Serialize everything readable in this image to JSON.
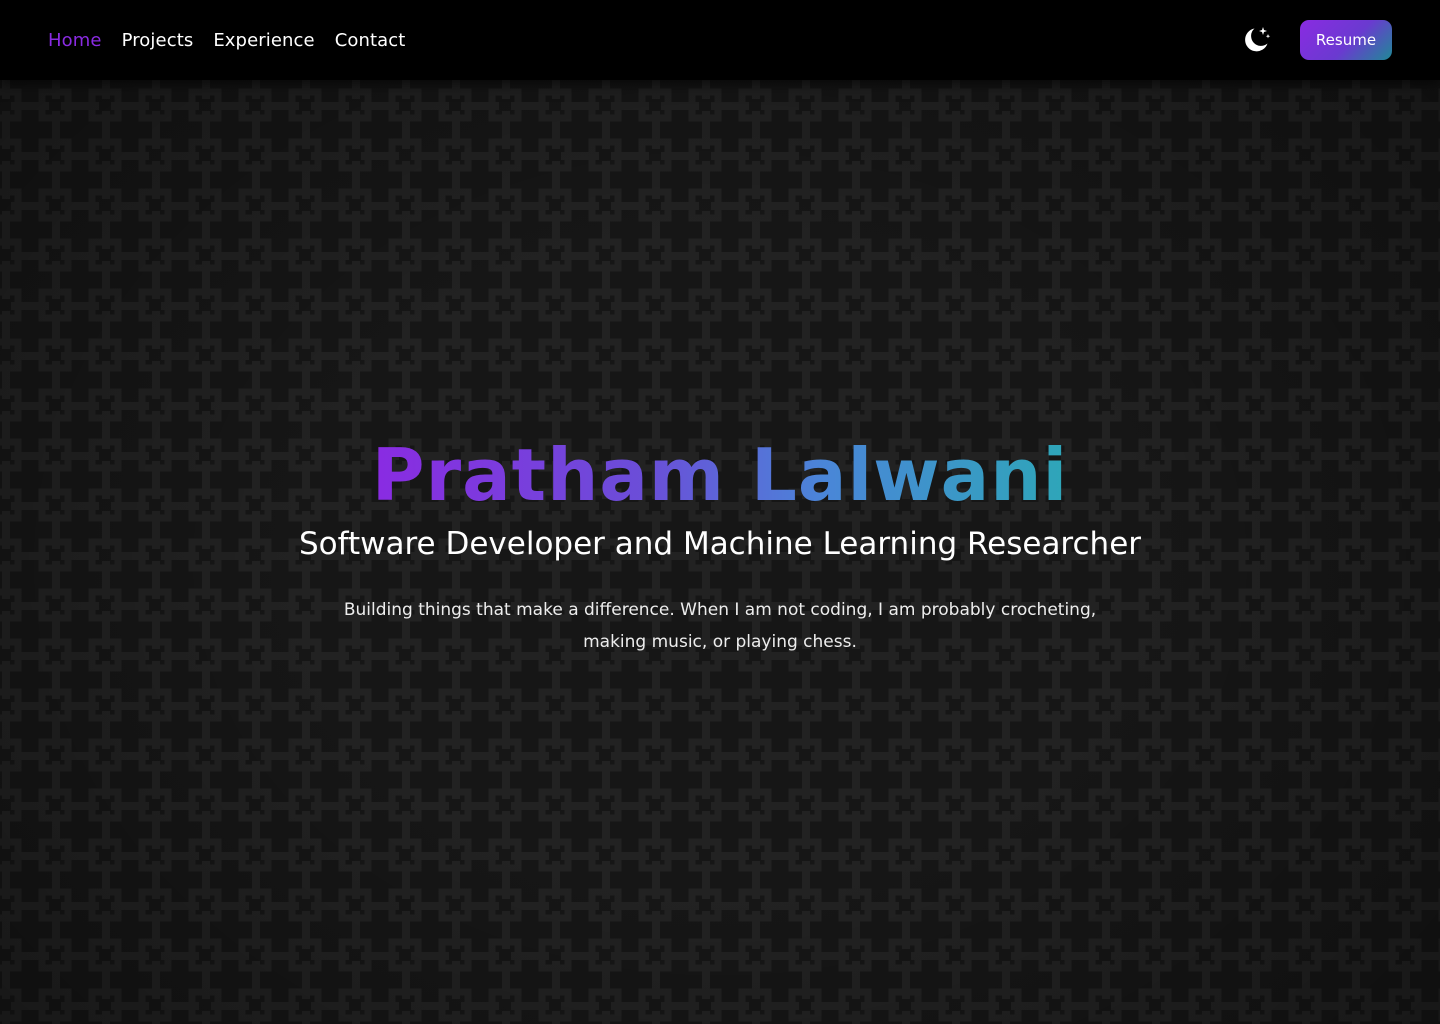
{
  "nav": {
    "links": [
      {
        "label": "Home",
        "active": true
      },
      {
        "label": "Projects",
        "active": false
      },
      {
        "label": "Experience",
        "active": false
      },
      {
        "label": "Contact",
        "active": false
      }
    ],
    "theme_icon": "moon-stars-icon",
    "resume_label": "Resume"
  },
  "hero": {
    "name": "Pratham Lalwani",
    "subtitle": "Software Developer and Machine Learning Researcher",
    "description": "Building things that make a difference. When I am not coding, I am probably crocheting, making music, or playing chess."
  },
  "colors": {
    "accent": "#8a2be2",
    "accent_secondary": "#2ea6b8",
    "navbar_bg": "#000000",
    "page_bg": "#161616",
    "pattern": "#242424"
  }
}
